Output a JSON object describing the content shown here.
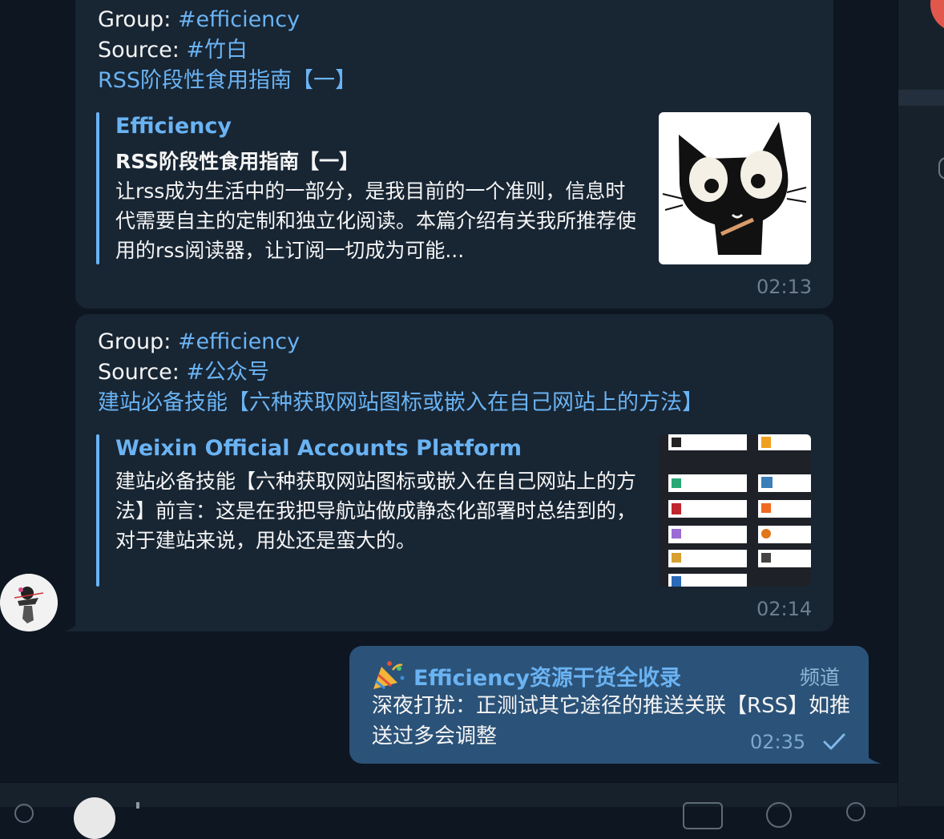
{
  "messages": [
    {
      "group_label": "Group: ",
      "group_tag": "#efficiency",
      "source_label": "Source: ",
      "source_tag": "#竹白",
      "link_text": "RSS阶段性食用指南【一】",
      "preview": {
        "site": "Efficiency",
        "title": "RSS阶段性食用指南【一】",
        "text": "让rss成为生活中的一部分，是我目前的一个准则，信息时代需要自主的定制和独立化阅读。本篇介绍有关我所推荐使用的rss阅读器，让订阅一切成为可能..."
      },
      "time": "02:13"
    },
    {
      "group_label": "Group: ",
      "group_tag": "#efficiency",
      "source_label": "Source: ",
      "source_tag": "#公众号",
      "link_text": "建站必备技能【六种获取网站图标或嵌入在自己网站上的方法】",
      "preview": {
        "site": "Weixin Official Accounts Platform",
        "text": "建站必备技能【六种获取网站图标或嵌入在自己网站上的方法】前言：这是在我把导航站做成静态化部署时总结到的，对于建站来说，用处还是蛮大的。"
      },
      "time": "02:14"
    }
  ],
  "outgoing": {
    "emoji": "🎉",
    "name": "Efficiency资源干货全收录",
    "badge": "频道",
    "text": "深夜打扰：正测试其它途径的推送关联【RSS】如推送过多会调整",
    "time": "02:35",
    "status_icon": "single-check-icon"
  },
  "colors": {
    "background": "#0e1621",
    "bubble_incoming": "#182533",
    "bubble_outgoing": "#2b5278",
    "link": "#6ab3f3",
    "text": "#f5f5f5",
    "muted": "#6d7f8f"
  }
}
